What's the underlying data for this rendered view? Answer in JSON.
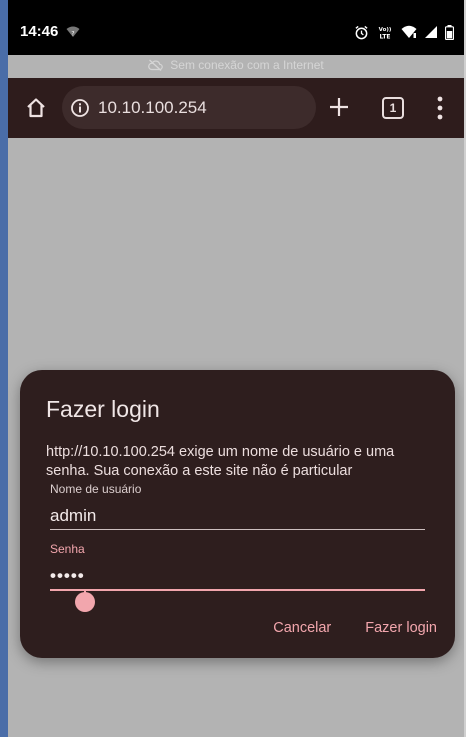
{
  "status_bar": {
    "time": "14:46",
    "icons": [
      "wifi-unknown-icon",
      "alarm-icon",
      "volte-icon",
      "wifi-icon",
      "signal-icon",
      "battery-icon"
    ],
    "volte_text": "VoLTE"
  },
  "banner": {
    "offline_text": "Sem conexão com a Internet",
    "icon": "cloud-off-icon"
  },
  "toolbar": {
    "url": "10.10.100.254",
    "tab_count": "1",
    "icons": [
      "home-icon",
      "info-icon",
      "plus-icon",
      "tabs-icon",
      "more-vert-icon"
    ]
  },
  "dialog": {
    "title": "Fazer login",
    "message": "http://10.10.100.254 exige um nome de usuário e uma senha. Sua conexão a este site não é particular",
    "username_label": "Nome de usuário",
    "username_value": "admin",
    "password_label": "Senha",
    "password_value": "•••••",
    "cancel_label": "Cancelar",
    "login_label": "Fazer login"
  },
  "colors": {
    "toolbar_bg": "#2e1c1c",
    "dialog_bg": "#2e1e1e",
    "accent": "#f2a6ad",
    "page_bg": "#b3b3b3"
  }
}
